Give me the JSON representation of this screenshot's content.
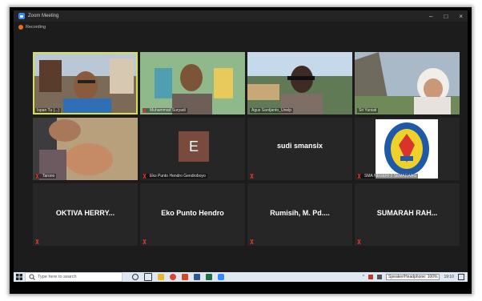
{
  "window": {
    "title": "Zoom Meeting",
    "recording_label": "Recording",
    "minimize": "–",
    "maximize": "□",
    "close": "×"
  },
  "participants": [
    {
      "name": "Ispan Tu (...)",
      "kind": "video",
      "active": true
    },
    {
      "name": "Muhammad Suryadi",
      "kind": "video"
    },
    {
      "name": "Agus Sardjanto_Unelp",
      "kind": "video"
    },
    {
      "name": "Sri Yuniati",
      "kind": "video"
    },
    {
      "name": "Tarono",
      "kind": "video"
    },
    {
      "name": "Eko Punto Hendro Gendroboyo",
      "kind": "avatar",
      "initial": "E"
    },
    {
      "name": "sudi smansix",
      "kind": "text",
      "label_name": ""
    },
    {
      "name": "SMA NEGERI 2 SEMARANG",
      "kind": "logo"
    },
    {
      "name": "OKTIVA  HERRY...",
      "kind": "text"
    },
    {
      "name": "Eko Punto Hendro",
      "kind": "text"
    },
    {
      "name": "Rumisih, M. Pd....",
      "kind": "text"
    },
    {
      "name": "SUMARAH  RAH...",
      "kind": "text"
    }
  ],
  "taskbar": {
    "search_placeholder": "Type here to search",
    "time": "19:10",
    "tray_text": "Speaker/Headphone: 100%"
  },
  "colors": {
    "active_border": "#d8e04a",
    "avatar_bg": "#7a4a3e",
    "mute_red": "#e0352b",
    "tile_bg": "#262626"
  }
}
